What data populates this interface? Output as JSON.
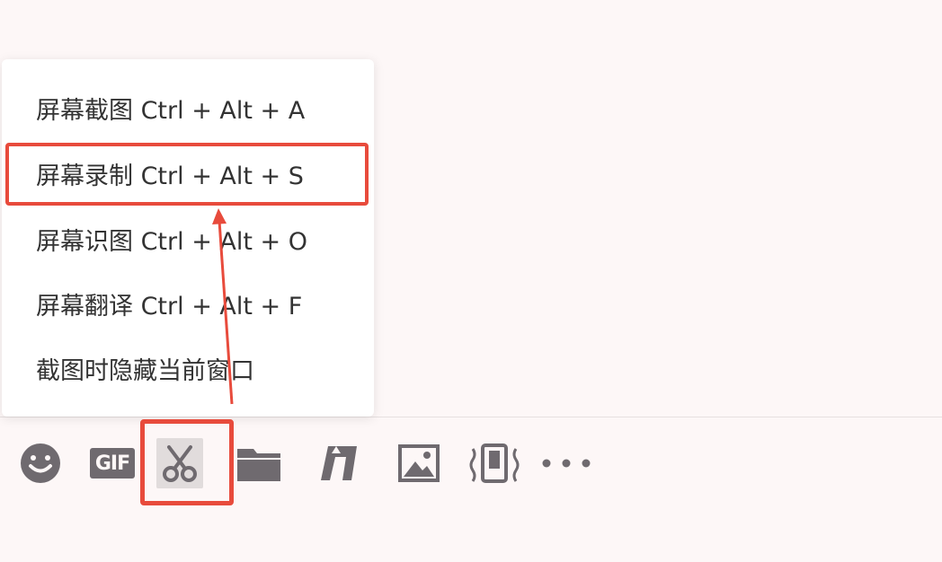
{
  "menu": {
    "items": [
      {
        "label": "屏幕截图 Ctrl + Alt + A"
      },
      {
        "label": "屏幕录制 Ctrl + Alt + S"
      },
      {
        "label": "屏幕识图 Ctrl + Alt + O"
      },
      {
        "label": "屏幕翻译 Ctrl + Alt + F"
      },
      {
        "label": "截图时隐藏当前窗口"
      }
    ]
  },
  "toolbar": {
    "gif_label": "GIF",
    "icons": [
      "emoji-icon",
      "gif-icon",
      "scissors-icon",
      "folder-icon",
      "file-transfer-icon",
      "image-icon",
      "shake-window-icon",
      "more-icon"
    ]
  },
  "colors": {
    "icon": "#6f6a6f",
    "highlight": "#e84b3c",
    "background": "#fdf7f7"
  }
}
